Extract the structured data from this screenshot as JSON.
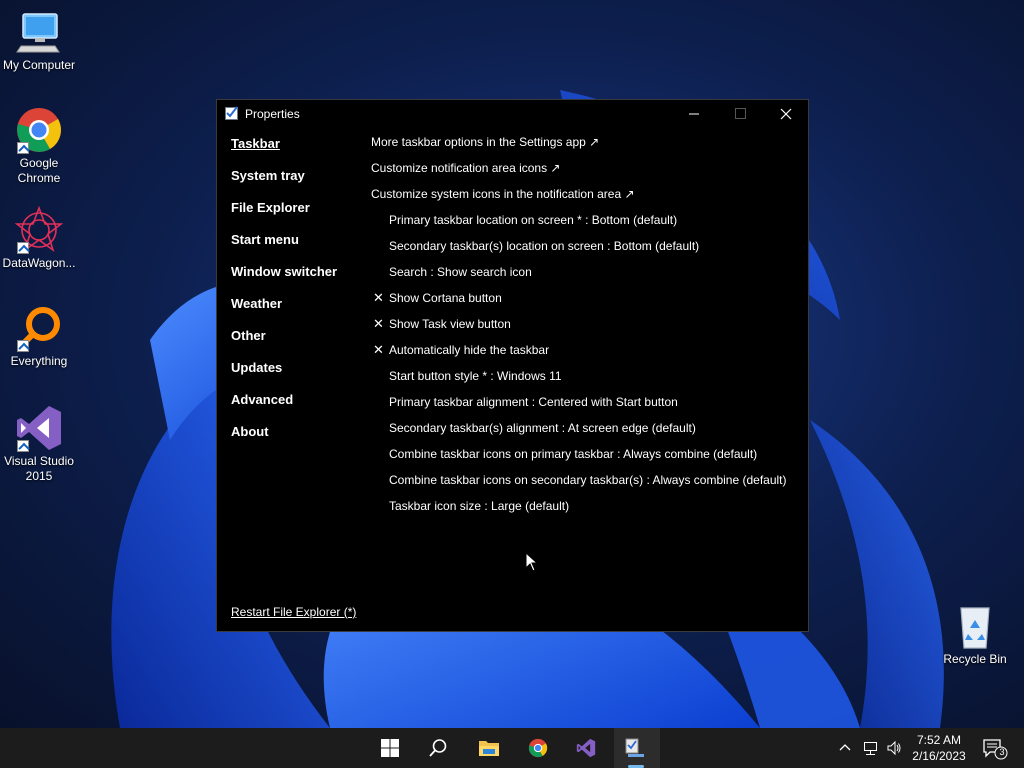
{
  "desktop": {
    "icons": [
      {
        "label": "My Computer"
      },
      {
        "label": "Google Chrome"
      },
      {
        "label": "DataWagon..."
      },
      {
        "label": "Everything"
      },
      {
        "label": "Visual Studio 2015"
      },
      {
        "label": "Recycle Bin"
      }
    ]
  },
  "window": {
    "title": "Properties",
    "nav": [
      {
        "label": "Taskbar",
        "active": true
      },
      {
        "label": "System tray"
      },
      {
        "label": "File Explorer"
      },
      {
        "label": "Start menu"
      },
      {
        "label": "Window switcher"
      },
      {
        "label": "Weather"
      },
      {
        "label": "Other"
      },
      {
        "label": "Updates"
      },
      {
        "label": "Advanced"
      },
      {
        "label": "About"
      }
    ],
    "options": [
      {
        "label": "More taskbar options in the Settings app ↗"
      },
      {
        "label": "Customize notification area icons ↗"
      },
      {
        "label": "Customize system icons in the notification area ↗"
      },
      {
        "label": "Primary taskbar location on screen * : Bottom (default)"
      },
      {
        "label": "Secondary taskbar(s) location on screen : Bottom (default)"
      },
      {
        "label": "Search : Show search icon"
      },
      {
        "label": "Show Cortana button",
        "mark": "✕"
      },
      {
        "label": "Show Task view button",
        "mark": "✕"
      },
      {
        "label": "Automatically hide the taskbar",
        "mark": "✕"
      },
      {
        "label": "Start button style * : Windows 11"
      },
      {
        "label": "Primary taskbar alignment : Centered with Start button"
      },
      {
        "label": "Secondary taskbar(s) alignment : At screen edge (default)"
      },
      {
        "label": "Combine taskbar icons on primary taskbar : Always combine (default)"
      },
      {
        "label": "Combine taskbar icons on secondary taskbar(s) : Always combine (default)"
      },
      {
        "label": "Taskbar icon size : Large (default)"
      }
    ],
    "restart_link": "Restart File Explorer (*)"
  },
  "taskbar": {
    "time": "7:52 AM",
    "date": "2/16/2023",
    "notification_count": "3"
  },
  "colors": {
    "accent": "#76b9ed",
    "window_bg": "#000000",
    "taskbar_bg": "#1c1c1c"
  }
}
